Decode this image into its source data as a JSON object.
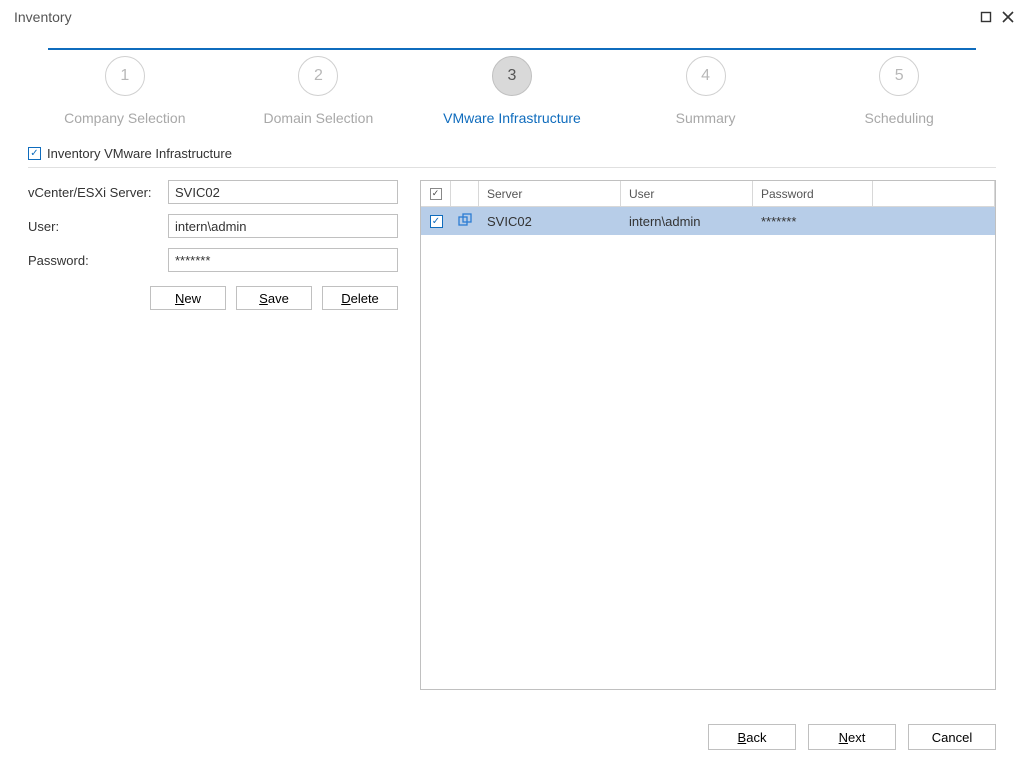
{
  "window": {
    "title": "Inventory"
  },
  "stepper": {
    "steps": [
      {
        "num": "1",
        "label": "Company Selection"
      },
      {
        "num": "2",
        "label": "Domain Selection"
      },
      {
        "num": "3",
        "label": "VMware Infrastructure"
      },
      {
        "num": "4",
        "label": "Summary"
      },
      {
        "num": "5",
        "label": "Scheduling"
      }
    ],
    "activeIndex": 2
  },
  "checkbox": {
    "label": "Inventory VMware Infrastructure",
    "checked": true
  },
  "form": {
    "server": {
      "label": "vCenter/ESXi Server:",
      "value": "SVIC02"
    },
    "user": {
      "label": "User:",
      "value": "intern\\admin"
    },
    "pass": {
      "label": "Password:",
      "value": "*******"
    },
    "buttons": {
      "new": "New",
      "save": "Save",
      "delete": "Delete"
    }
  },
  "grid": {
    "headers": {
      "server": "Server",
      "user": "User",
      "password": "Password"
    },
    "headerChecked": true,
    "rows": [
      {
        "checked": true,
        "server": "SVIC02",
        "user": "intern\\admin",
        "password": "*******",
        "selected": true
      }
    ]
  },
  "footer": {
    "back": "Back",
    "next": "Next",
    "cancel": "Cancel"
  }
}
